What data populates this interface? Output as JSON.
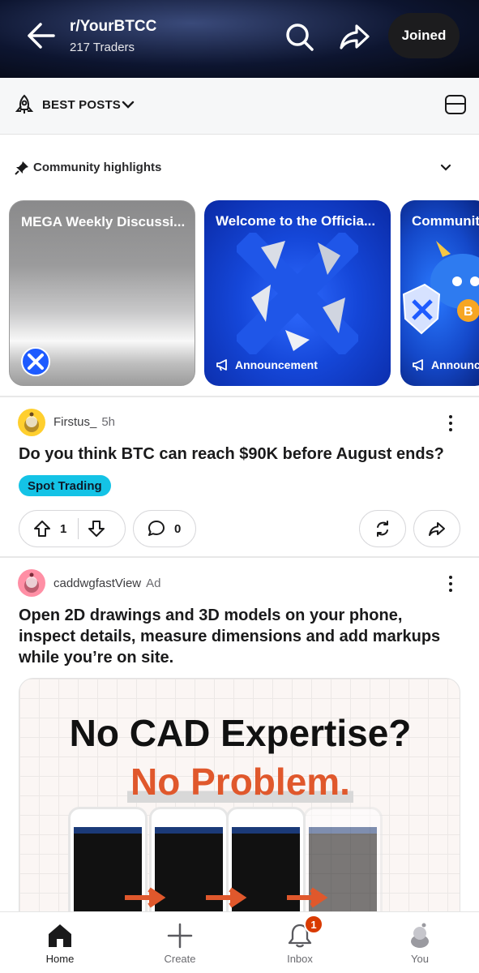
{
  "header": {
    "title": "r/YourBTCC",
    "subtitle": "217 Traders",
    "joined_label": "Joined"
  },
  "sort": {
    "label": "BEST POSTS"
  },
  "highlights": {
    "heading": "Community highlights",
    "cards": [
      {
        "title": "MEGA Weekly Discussi...",
        "tag": ""
      },
      {
        "title": "Welcome to the Officia...",
        "tag": "Announcement"
      },
      {
        "title": "Communit",
        "tag": "Announcement"
      }
    ]
  },
  "posts": [
    {
      "author": "Firstus_",
      "time": "5h",
      "title": "Do you think BTC can reach $90K before August ends?",
      "flair": "Spot Trading",
      "votes": "1",
      "comments": "0"
    }
  ],
  "ad": {
    "author": "caddwgfastView",
    "label": "Ad",
    "title": "Open 2D drawings and 3D models on your phone, inspect details, measure dimensions and add markups while you’re on site.",
    "image_line1": "No CAD Expertise?",
    "image_line2": "No Problem."
  },
  "nav": {
    "items": [
      "Home",
      "Create",
      "Inbox",
      "You"
    ],
    "inbox_badge": "1"
  },
  "colors": {
    "accent": "#14c3e6",
    "badge": "#d93a00",
    "ad_accent": "#e0582c"
  }
}
